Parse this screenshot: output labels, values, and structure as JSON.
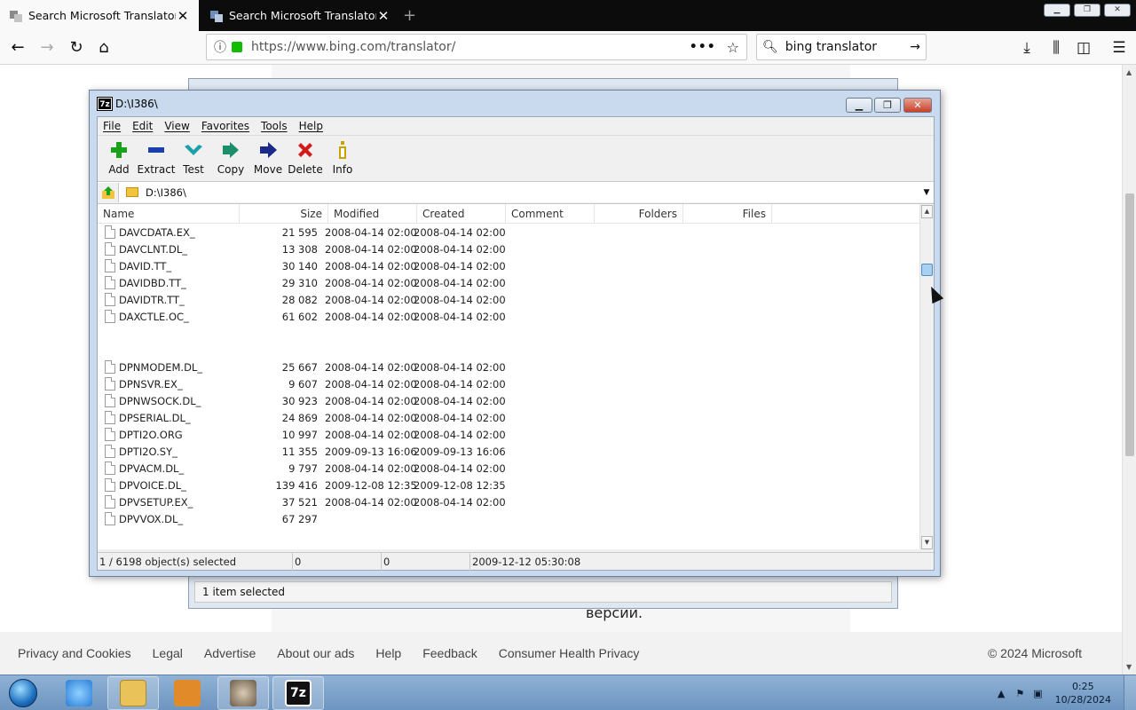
{
  "browser": {
    "tabs": [
      {
        "title": "Search Microsoft Translator",
        "active": true
      },
      {
        "title": "Search Microsoft Translator",
        "active": false
      }
    ],
    "new_tab_glyph": "+",
    "url": "https://www.bing.com/translator/",
    "search_query": "bing translator",
    "accent": "#12bc00"
  },
  "page": {
    "background_text": "версии.",
    "footer_links": [
      "Privacy and Cookies",
      "Legal",
      "Advertise",
      "About our ads",
      "Help",
      "Feedback",
      "Consumer Health Privacy"
    ],
    "copyright": "© 2024 Microsoft"
  },
  "back_window": {
    "status": "1 item selected"
  },
  "sevenzip": {
    "title": "D:\\I386\\",
    "menu": [
      "File",
      "Edit",
      "View",
      "Favorites",
      "Tools",
      "Help"
    ],
    "toolbar": [
      {
        "label": "Add",
        "icon": "plus-icon",
        "color": "#1aa11a"
      },
      {
        "label": "Extract",
        "icon": "minus-icon",
        "color": "#1b3fa8"
      },
      {
        "label": "Test",
        "icon": "check-icon",
        "color": "#1aa0a8"
      },
      {
        "label": "Copy",
        "icon": "double-arrow-icon",
        "color": "#1a8f6a"
      },
      {
        "label": "Move",
        "icon": "arrow-right-icon",
        "color": "#1b2a8a"
      },
      {
        "label": "Delete",
        "icon": "x-icon",
        "color": "#d11a1a"
      },
      {
        "label": "Info",
        "icon": "info-icon",
        "color": "#c9a200"
      }
    ],
    "path": "D:\\I386\\",
    "columns": [
      "Name",
      "Size",
      "Modified",
      "Created",
      "Comment",
      "Folders",
      "Files"
    ],
    "rows_top": [
      {
        "name": "DAVCDATA.EX_",
        "size": "21 595",
        "modified": "2008-04-14 02:00",
        "created": "2008-04-14 02:00"
      },
      {
        "name": "DAVCLNT.DL_",
        "size": "13 308",
        "modified": "2008-04-14 02:00",
        "created": "2008-04-14 02:00"
      },
      {
        "name": "DAVID.TT_",
        "size": "30 140",
        "modified": "2008-04-14 02:00",
        "created": "2008-04-14 02:00"
      },
      {
        "name": "DAVIDBD.TT_",
        "size": "29 310",
        "modified": "2008-04-14 02:00",
        "created": "2008-04-14 02:00"
      },
      {
        "name": "DAVIDTR.TT_",
        "size": "28 082",
        "modified": "2008-04-14 02:00",
        "created": "2008-04-14 02:00"
      },
      {
        "name": "DAXCTLE.OC_",
        "size": "61 602",
        "modified": "2008-04-14 02:00",
        "created": "2008-04-14 02:00"
      }
    ],
    "rows_bottom": [
      {
        "name": "DPNMODEM.DL_",
        "size": "25 667",
        "modified": "2008-04-14 02:00",
        "created": "2008-04-14 02:00"
      },
      {
        "name": "DPNSVR.EX_",
        "size": "9 607",
        "modified": "2008-04-14 02:00",
        "created": "2008-04-14 02:00"
      },
      {
        "name": "DPNWSOCK.DL_",
        "size": "30 923",
        "modified": "2008-04-14 02:00",
        "created": "2008-04-14 02:00"
      },
      {
        "name": "DPSERIAL.DL_",
        "size": "24 869",
        "modified": "2008-04-14 02:00",
        "created": "2008-04-14 02:00"
      },
      {
        "name": "DPTI2O.ORG",
        "size": "10 997",
        "modified": "2008-04-14 02:00",
        "created": "2008-04-14 02:00"
      },
      {
        "name": "DPTI2O.SY_",
        "size": "11 355",
        "modified": "2009-09-13 16:06",
        "created": "2009-09-13 16:06"
      },
      {
        "name": "DPVACM.DL_",
        "size": "9 797",
        "modified": "2008-04-14 02:00",
        "created": "2008-04-14 02:00"
      },
      {
        "name": "DPVOICE.DL_",
        "size": "139 416",
        "modified": "2009-12-08 12:35",
        "created": "2009-12-08 12:35"
      },
      {
        "name": "DPVSETUP.EX_",
        "size": "37 521",
        "modified": "2008-04-14 02:00",
        "created": "2008-04-14 02:00"
      },
      {
        "name": "DPVVOX.DL_",
        "size": "67 297",
        "modified": "",
        "created": ""
      }
    ],
    "status": [
      "1 / 6198 object(s) selected",
      "0",
      "0",
      "2009-12-12 05:30:08"
    ]
  },
  "taskbar": {
    "items": [
      {
        "name": "internet-explorer-icon",
        "color": "#2b7fd8"
      },
      {
        "name": "file-explorer-icon",
        "color": "#e9c35a"
      },
      {
        "name": "media-player-icon",
        "color": "#e08a2a"
      },
      {
        "name": "raccoon-app-icon",
        "color": "#6b5a48"
      },
      {
        "name": "sevenzip-taskbar-icon",
        "color": "#111111"
      }
    ],
    "time": "0:25",
    "date": "10/28/2024"
  }
}
